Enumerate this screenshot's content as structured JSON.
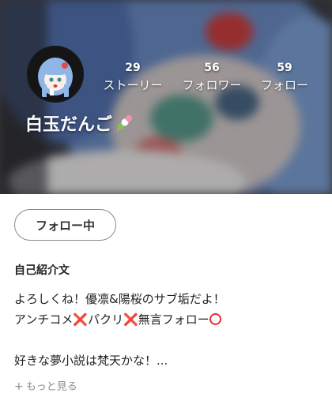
{
  "profile": {
    "username": "白玉だんご",
    "username_emoji": "dango-icon",
    "stats": [
      {
        "count": "29",
        "label": "ストーリー"
      },
      {
        "count": "56",
        "label": "フォロワー"
      },
      {
        "count": "59",
        "label": "フォロー"
      }
    ],
    "follow_button_label": "フォロー中"
  },
  "bio": {
    "heading": "自己紹介文",
    "line1": "よろしくね！優凛&陽桜のサブ垢だよ！",
    "line2": {
      "part1": "アンチコメ",
      "mark1": "❌",
      "part2": "パクリ",
      "mark2": "❌",
      "part3": "無言フォロー",
      "end_icon": "circle-icon"
    },
    "line3": "好きな夢小説は梵天かな！...",
    "more_label": "もっと見る"
  },
  "colors": {
    "accent_x": "#f07020",
    "circle_red": "#e0303a",
    "muted_text": "#8c8c8c"
  }
}
